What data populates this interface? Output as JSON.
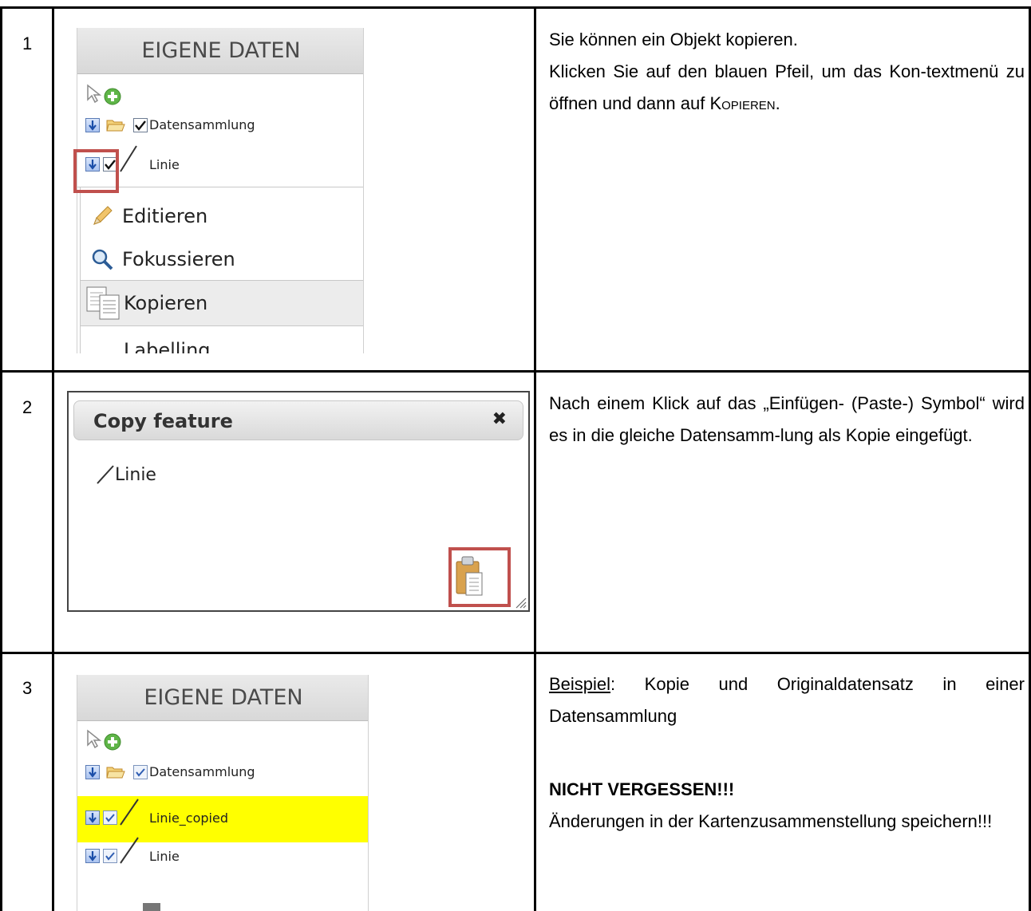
{
  "rows": [
    {
      "number": "1",
      "text": [
        "Sie können ein Objekt kopieren.",
        "Klicken Sie auf den blauen Pfeil, um das Kon-textmenü zu öffnen und dann auf "
      ],
      "text_emphasis": "Kopieren",
      "text_end": "."
    },
    {
      "number": "2",
      "text": "Nach einem Klick auf das „Einfügen- (Paste-) Symbol“ wird es in die gleiche Datensamm-lung als Kopie eingefügt."
    },
    {
      "number": "3",
      "text_underlined": "Beispiel",
      "text_rest": ": Kopie und Originaldatensatz in einer Datensammlung",
      "warning": "NICHT VERGESSEN!!!",
      "warning_text": "Änderungen in der Kartenzusammenstellung speichern!!!"
    }
  ],
  "panel1": {
    "header": "EIGENE DATEN",
    "collection_label": "Datensammlung",
    "item_label": "Linie",
    "menu": [
      "Editieren",
      "Fokussieren",
      "Kopieren",
      "Labelling"
    ],
    "selected_menu": "Kopieren"
  },
  "dialog": {
    "title": "Copy feature",
    "close_glyph": "✖",
    "item_label": "Linie"
  },
  "panel3": {
    "header": "EIGENE DATEN",
    "collection_label": "Datensammlung",
    "items": [
      "Linie_copied",
      "Linie"
    ],
    "highlight_color": "#ffff00"
  },
  "colors": {
    "annotation_box": "#c0504d",
    "highlight": "#ffff00"
  }
}
